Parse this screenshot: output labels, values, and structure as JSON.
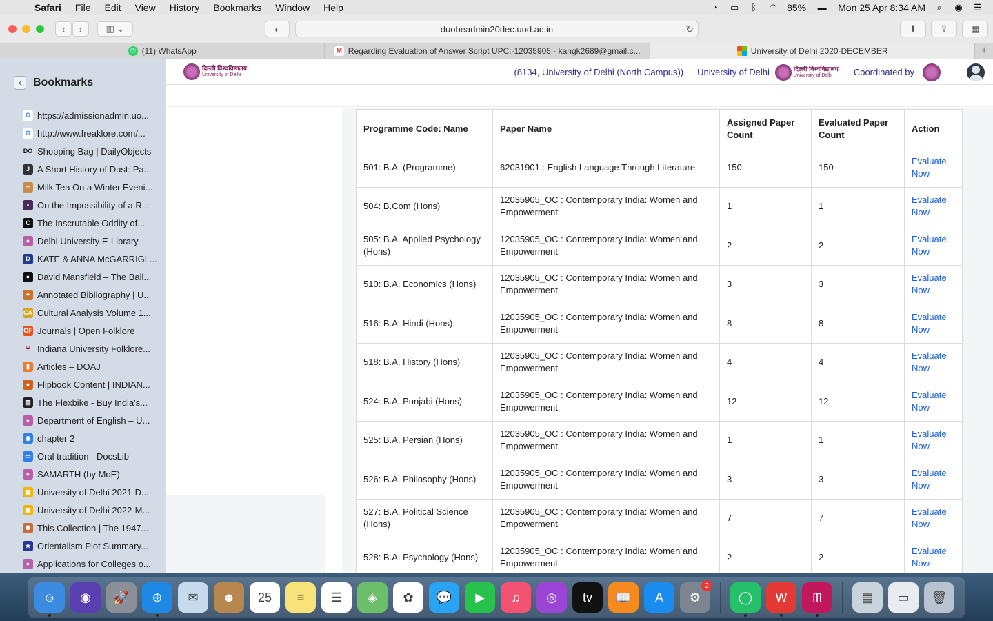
{
  "menubar": {
    "items": [
      "Safari",
      "File",
      "Edit",
      "View",
      "History",
      "Bookmarks",
      "Window",
      "Help"
    ],
    "battery": "85%",
    "clock": "Mon 25 Apr  8:34 AM"
  },
  "toolbar": {
    "url": "duobeadmin20dec.uod.ac.in"
  },
  "tabs": [
    {
      "title": "(11) WhatsApp",
      "icon": "whatsapp-icon",
      "color": "#25d366"
    },
    {
      "title": "Regarding Evaluation of Answer Script UPC:-12035905 - kangk2689@gmail.c...",
      "icon": "gmail-icon",
      "color": "#d93025"
    },
    {
      "title": "University of Delhi 2020-DECEMBER",
      "icon": "microsoft-icon",
      "color": "#f25022"
    }
  ],
  "sidebar": {
    "title": "Bookmarks",
    "items": [
      {
        "label": "https://admissionadmin.uo...",
        "fav": "G",
        "color": "#ffffff",
        "fg": "#4285f4"
      },
      {
        "label": "http://www.freaklore.com/...",
        "fav": "G",
        "color": "#ffffff",
        "fg": "#4285f4"
      },
      {
        "label": "Shopping Bag | DailyObjects",
        "fav": "DO",
        "color": "#d3dbe6",
        "fg": "#111"
      },
      {
        "label": "A Short History of Dust: Pa...",
        "fav": "J",
        "color": "#333333",
        "fg": "#fff"
      },
      {
        "label": "Milk Tea On a Winter Eveni...",
        "fav": "~",
        "color": "#c98a4a",
        "fg": "#fff"
      },
      {
        "label": "On the Impossibility of a R...",
        "fav": "▪",
        "color": "#4a2a5a",
        "fg": "#fff"
      },
      {
        "label": "The Inscrutable Oddity of...",
        "fav": "C",
        "color": "#111111",
        "fg": "#fff"
      },
      {
        "label": "Delhi University E-Library",
        "fav": "●",
        "color": "#b85fa8",
        "fg": "#fff"
      },
      {
        "label": "KATE & ANNA McGARRIGL...",
        "fav": "D",
        "color": "#1f3c8c",
        "fg": "#fff"
      },
      {
        "label": "David Mansfield – The Ball...",
        "fav": "●",
        "color": "#111111",
        "fg": "#fff"
      },
      {
        "label": "Annotated Bibliography | U...",
        "fav": "✦",
        "color": "#c9722a",
        "fg": "#fff"
      },
      {
        "label": "Cultural Analysis Volume 1...",
        "fav": "CA",
        "color": "#d9a21f",
        "fg": "#fff"
      },
      {
        "label": "Journals | Open Folklore",
        "fav": "OF",
        "color": "#e8541f",
        "fg": "#fff"
      },
      {
        "label": "Indiana University Folklore...",
        "fav": "Ψ",
        "color": "#d3dbe6",
        "fg": "#990000"
      },
      {
        "label": "Articles – DOAJ",
        "fav": "▮",
        "color": "#f07a2c",
        "fg": "#fff"
      },
      {
        "label": "Flipbook Content | INDIAN...",
        "fav": "●",
        "color": "#d0601c",
        "fg": "#fff"
      },
      {
        "label": "The Flexbike - Buy India's...",
        "fav": "▤",
        "color": "#222222",
        "fg": "#fff"
      },
      {
        "label": "Department of English – U...",
        "fav": "●",
        "color": "#b85fa8",
        "fg": "#fff"
      },
      {
        "label": "chapter 2",
        "fav": "◉",
        "color": "#2f80ed",
        "fg": "#fff"
      },
      {
        "label": "Oral tradition - DocsLib",
        "fav": "▭",
        "color": "#2f80ed",
        "fg": "#fff"
      },
      {
        "label": "SAMARTH (by MoE)",
        "fav": "●",
        "color": "#b85fa8",
        "fg": "#fff"
      },
      {
        "label": "University of Delhi 2021-D...",
        "fav": "▦",
        "color": "#f4b400",
        "fg": "#fff"
      },
      {
        "label": "University of Delhi 2022-M...",
        "fav": "▦",
        "color": "#f4b400",
        "fg": "#fff"
      },
      {
        "label": "This Collection | The 1947...",
        "fav": "✺",
        "color": "#c86a3a",
        "fg": "#fff"
      },
      {
        "label": "Orientalism Plot Summary...",
        "fav": "★",
        "color": "#283593",
        "fg": "#fff"
      },
      {
        "label": "Applications for Colleges o...",
        "fav": "●",
        "color": "#b85fa8",
        "fg": "#fff"
      }
    ]
  },
  "site": {
    "logo_hindi": "दिल्ली विश्वविद्यालय",
    "logo_english": "University of Delhi",
    "college": "(8134, University of Delhi (North Campus))",
    "university": "University of Delhi",
    "coordinated": "Coordinated by"
  },
  "table": {
    "headers": [
      "Programme Code: Name",
      "Paper Name",
      "Assigned Paper Count",
      "Evaluated Paper Count",
      "Action"
    ],
    "rows": [
      {
        "programme": "501: B.A. (Programme)",
        "paper": "62031901 : English Language Through Literature",
        "assigned": "150",
        "evaluated": "150",
        "action": "Evaluate Now"
      },
      {
        "programme": "504: B.Com (Hons)",
        "paper": "12035905_OC : Contemporary India: Women and Empowerment",
        "assigned": "1",
        "evaluated": "1",
        "action": "Evaluate Now"
      },
      {
        "programme": "505: B.A. Applied Psychology (Hons)",
        "paper": "12035905_OC : Contemporary India: Women and Empowerment",
        "assigned": "2",
        "evaluated": "2",
        "action": "Evaluate Now"
      },
      {
        "programme": "510: B.A. Economics (Hons)",
        "paper": "12035905_OC : Contemporary India: Women and Empowerment",
        "assigned": "3",
        "evaluated": "3",
        "action": "Evaluate Now"
      },
      {
        "programme": "516: B.A. Hindi (Hons)",
        "paper": "12035905_OC : Contemporary India: Women and Empowerment",
        "assigned": "8",
        "evaluated": "8",
        "action": "Evaluate Now"
      },
      {
        "programme": "518: B.A. History (Hons)",
        "paper": "12035905_OC : Contemporary India: Women and Empowerment",
        "assigned": "4",
        "evaluated": "4",
        "action": "Evaluate Now"
      },
      {
        "programme": "524: B.A. Punjabi (Hons)",
        "paper": "12035905_OC : Contemporary India: Women and Empowerment",
        "assigned": "12",
        "evaluated": "12",
        "action": "Evaluate Now"
      },
      {
        "programme": "525: B.A. Persian (Hons)",
        "paper": "12035905_OC : Contemporary India: Women and Empowerment",
        "assigned": "1",
        "evaluated": "1",
        "action": "Evaluate Now"
      },
      {
        "programme": "526: B.A. Philosophy (Hons)",
        "paper": "12035905_OC : Contemporary India: Women and Empowerment",
        "assigned": "3",
        "evaluated": "3",
        "action": "Evaluate Now"
      },
      {
        "programme": "527: B.A. Political Science (Hons)",
        "paper": "12035905_OC : Contemporary India: Women and Empowerment",
        "assigned": "7",
        "evaluated": "7",
        "action": "Evaluate Now"
      },
      {
        "programme": "528: B.A. Psychology (Hons)",
        "paper": "12035905_OC : Contemporary India: Women and Empowerment",
        "assigned": "2",
        "evaluated": "2",
        "action": "Evaluate Now"
      }
    ]
  },
  "dock": {
    "apps": [
      {
        "name": "finder-icon",
        "color": "#3b8ce0",
        "glyph": "☺",
        "running": true
      },
      {
        "name": "siri-icon",
        "color": "#5a3fb0",
        "glyph": "◉",
        "running": false
      },
      {
        "name": "launchpad-icon",
        "color": "#8a8f98",
        "glyph": "🚀",
        "running": false
      },
      {
        "name": "safari-icon",
        "color": "#1e88e5",
        "glyph": "⊕",
        "running": true
      },
      {
        "name": "mail-icon",
        "color": "#c8dbee",
        "glyph": "✉",
        "running": false
      },
      {
        "name": "contacts-icon",
        "color": "#b8874f",
        "glyph": "☻",
        "running": false
      },
      {
        "name": "calendar-icon",
        "color": "#ffffff",
        "glyph": "25",
        "running": false
      },
      {
        "name": "notes-icon",
        "color": "#f7e37a",
        "glyph": "≡",
        "running": false
      },
      {
        "name": "reminders-icon",
        "color": "#ffffff",
        "glyph": "☰",
        "running": false
      },
      {
        "name": "maps-icon",
        "color": "#6bbf6a",
        "glyph": "◈",
        "running": false
      },
      {
        "name": "photos-icon",
        "color": "#ffffff",
        "glyph": "✿",
        "running": false
      },
      {
        "name": "messages-icon",
        "color": "#29a3f2",
        "glyph": "💬",
        "running": false
      },
      {
        "name": "facetime-icon",
        "color": "#27c24c",
        "glyph": "▶",
        "running": false
      },
      {
        "name": "music-icon",
        "color": "#f25372",
        "glyph": "♫",
        "running": false
      },
      {
        "name": "podcasts-icon",
        "color": "#9a45d6",
        "glyph": "◎",
        "running": false
      },
      {
        "name": "apple-tv-icon",
        "color": "#111111",
        "glyph": "tv",
        "running": false
      },
      {
        "name": "books-icon",
        "color": "#f58a1f",
        "glyph": "📖",
        "running": false
      },
      {
        "name": "app-store-icon",
        "color": "#1a8cf0",
        "glyph": "A",
        "running": false
      },
      {
        "name": "system-preferences-icon",
        "color": "#7d8590",
        "glyph": "⚙",
        "running": false,
        "badge": "2"
      },
      {
        "name": "whatsapp-icon",
        "color": "#25c06a",
        "glyph": "◯",
        "running": true
      },
      {
        "name": "wps-icon",
        "color": "#e53935",
        "glyph": "W",
        "running": true
      },
      {
        "name": "mendeley-icon",
        "color": "#c2185b",
        "glyph": "ᗰ",
        "running": true
      },
      {
        "name": "downloads-stack-icon",
        "color": "#c9d3dc",
        "glyph": "▤",
        "running": false
      },
      {
        "name": "documents-stack-icon",
        "color": "#e8ecf0",
        "glyph": "▭",
        "running": false
      },
      {
        "name": "trash-icon",
        "color": "#b7c3ce",
        "glyph": "🗑",
        "running": false
      }
    ]
  }
}
